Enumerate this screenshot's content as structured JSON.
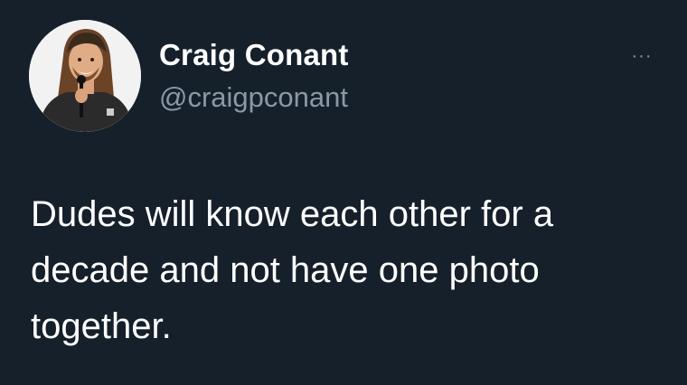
{
  "tweet": {
    "author": {
      "display_name": "Craig Conant",
      "handle": "@craigpconant",
      "avatar_icon": "profile-photo"
    },
    "more_icon": "more-options-icon",
    "more_label": "···",
    "text": "Dudes will know each other for a\ndecade and not have one photo\ntogether."
  },
  "colors": {
    "background": "#15202b",
    "primary_text": "#ffffff",
    "secondary_text": "#8b98a5"
  }
}
